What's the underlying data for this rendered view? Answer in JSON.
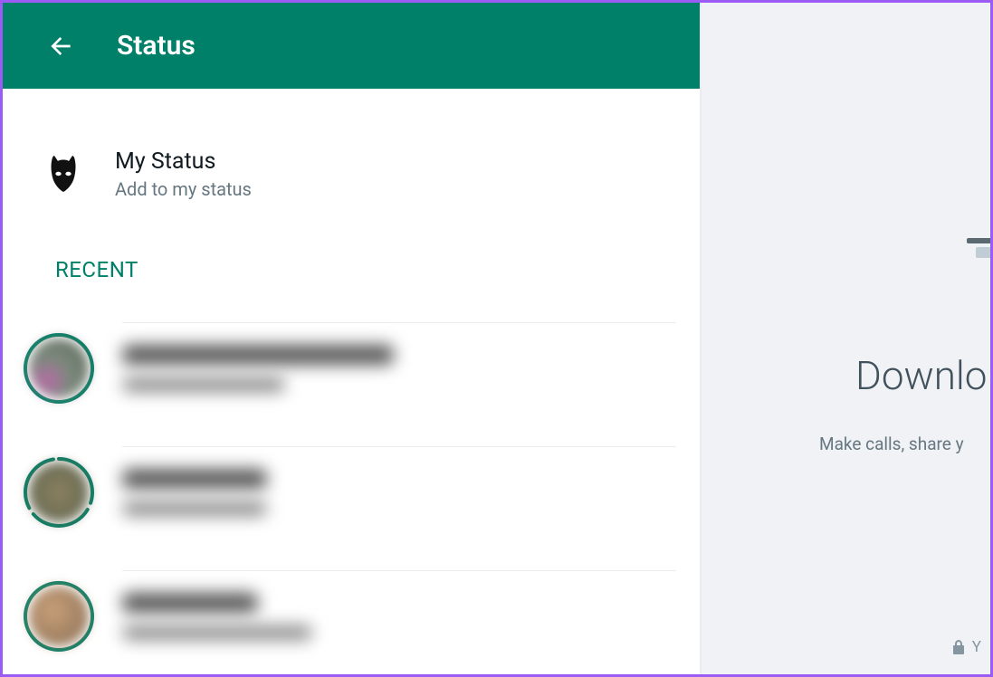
{
  "colors": {
    "accent": "#008069",
    "border": "#9b5cf6"
  },
  "header": {
    "title": "Status"
  },
  "my_status": {
    "title": "My Status",
    "subtitle": "Add to my status",
    "avatar_icon": "batman-mask-icon"
  },
  "section_label": "RECENT",
  "status_items": [
    {
      "segments": 1,
      "avatar_style": "a1"
    },
    {
      "segments": 3,
      "avatar_style": "a2"
    },
    {
      "segments": 1,
      "avatar_style": "a3"
    }
  ],
  "right_panel": {
    "title": "Downlo",
    "subtitle": "Make calls, share y",
    "footer": "Y",
    "footer_icon": "lock-icon"
  }
}
